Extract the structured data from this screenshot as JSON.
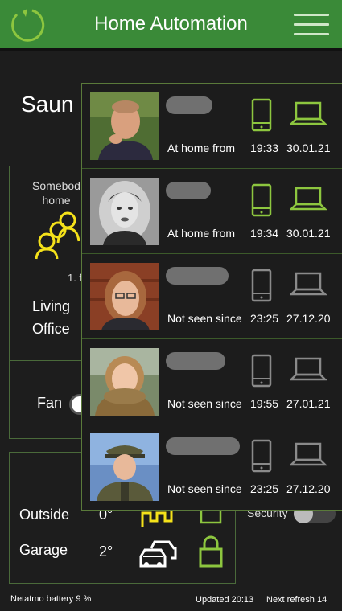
{
  "header": {
    "title": "Home Automation"
  },
  "room": {
    "title": "Saun"
  },
  "presence": {
    "label_line1": "Somebod",
    "label_line2": "home",
    "floor_label": "1. f"
  },
  "rooms": {
    "living": "Living",
    "office": "Office",
    "fan": "Fan"
  },
  "climate": {
    "outside_label": "Outside",
    "outside_value": "0°",
    "garage_label": "Garage",
    "garage_value": "2°",
    "security_label": "Security"
  },
  "footer": {
    "battery": "Netatmo battery 9 %",
    "updated": "Updated  20:13",
    "next_refresh": "Next refresh 14"
  },
  "people": [
    {
      "status": "At home from",
      "time": "19:33",
      "date": "30.01.21",
      "home": true
    },
    {
      "status": "At home from",
      "time": "19:34",
      "date": "30.01.21",
      "home": true
    },
    {
      "status": "Not seen since",
      "time": "23:25",
      "date": "27.12.20",
      "home": false
    },
    {
      "status": "Not seen since",
      "time": "19:55",
      "date": "27.01.21",
      "home": false
    },
    {
      "status": "Not seen since",
      "time": "23:25",
      "date": "27.12.20",
      "home": false
    }
  ],
  "colors": {
    "accent_green": "#3a8a38",
    "device_green": "#8dc63f",
    "device_gray": "#8a8a8a",
    "presence_yellow": "#f5e21a"
  }
}
